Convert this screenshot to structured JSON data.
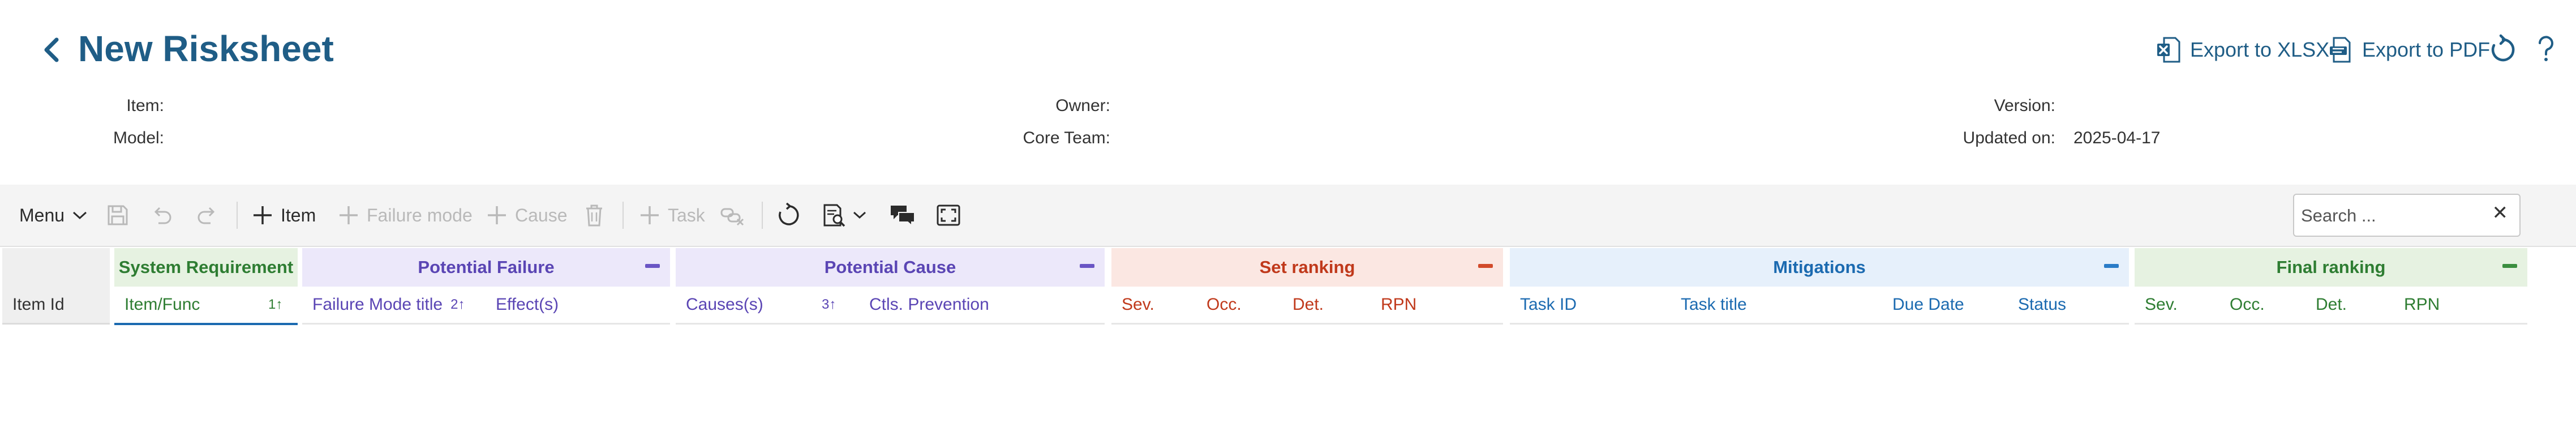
{
  "header": {
    "title": "New Risksheet",
    "export_xlsx": "Export to XLSX",
    "export_pdf": "Export to PDF"
  },
  "meta": {
    "item_label": "Item:",
    "model_label": "Model:",
    "owner_label": "Owner:",
    "core_team_label": "Core Team:",
    "version_label": "Version:",
    "updated_label": "Updated on:",
    "updated_value": "2025-04-17"
  },
  "toolbar": {
    "menu": "Menu",
    "item": "Item",
    "failure_mode": "Failure mode",
    "cause": "Cause",
    "task": "Task",
    "search_placeholder": "Search ..."
  },
  "grid": {
    "id_col": "Item Id",
    "system_requirement": {
      "title": "System Requirement",
      "item_func": "Item/Func",
      "item_func_sort": "1↑"
    },
    "potential_failure": {
      "title": "Potential Failure",
      "failure_mode_title": "Failure Mode title",
      "failure_mode_sort": "2↑",
      "effects": "Effect(s)"
    },
    "potential_cause": {
      "title": "Potential Cause",
      "causes": "Causes(s)",
      "causes_sort": "3↑",
      "ctls_prevention": "Ctls. Prevention"
    },
    "set_ranking": {
      "title": "Set ranking",
      "sev": "Sev.",
      "occ": "Occ.",
      "det": "Det.",
      "rpn": "RPN"
    },
    "mitigations": {
      "title": "Mitigations",
      "task_id": "Task ID",
      "task_title": "Task title",
      "due_date": "Due Date",
      "status": "Status"
    },
    "final_ranking": {
      "title": "Final ranking",
      "sev": "Sev.",
      "occ": "Occ.",
      "det": "Det.",
      "rpn": "RPN"
    }
  },
  "colors": {
    "title_blue": "#1f5d86",
    "requirement_green": "#2e7d32",
    "failure_purple": "#5a45b4",
    "ranking_red": "#c0391b",
    "mitigation_blue": "#1b6ab0"
  }
}
